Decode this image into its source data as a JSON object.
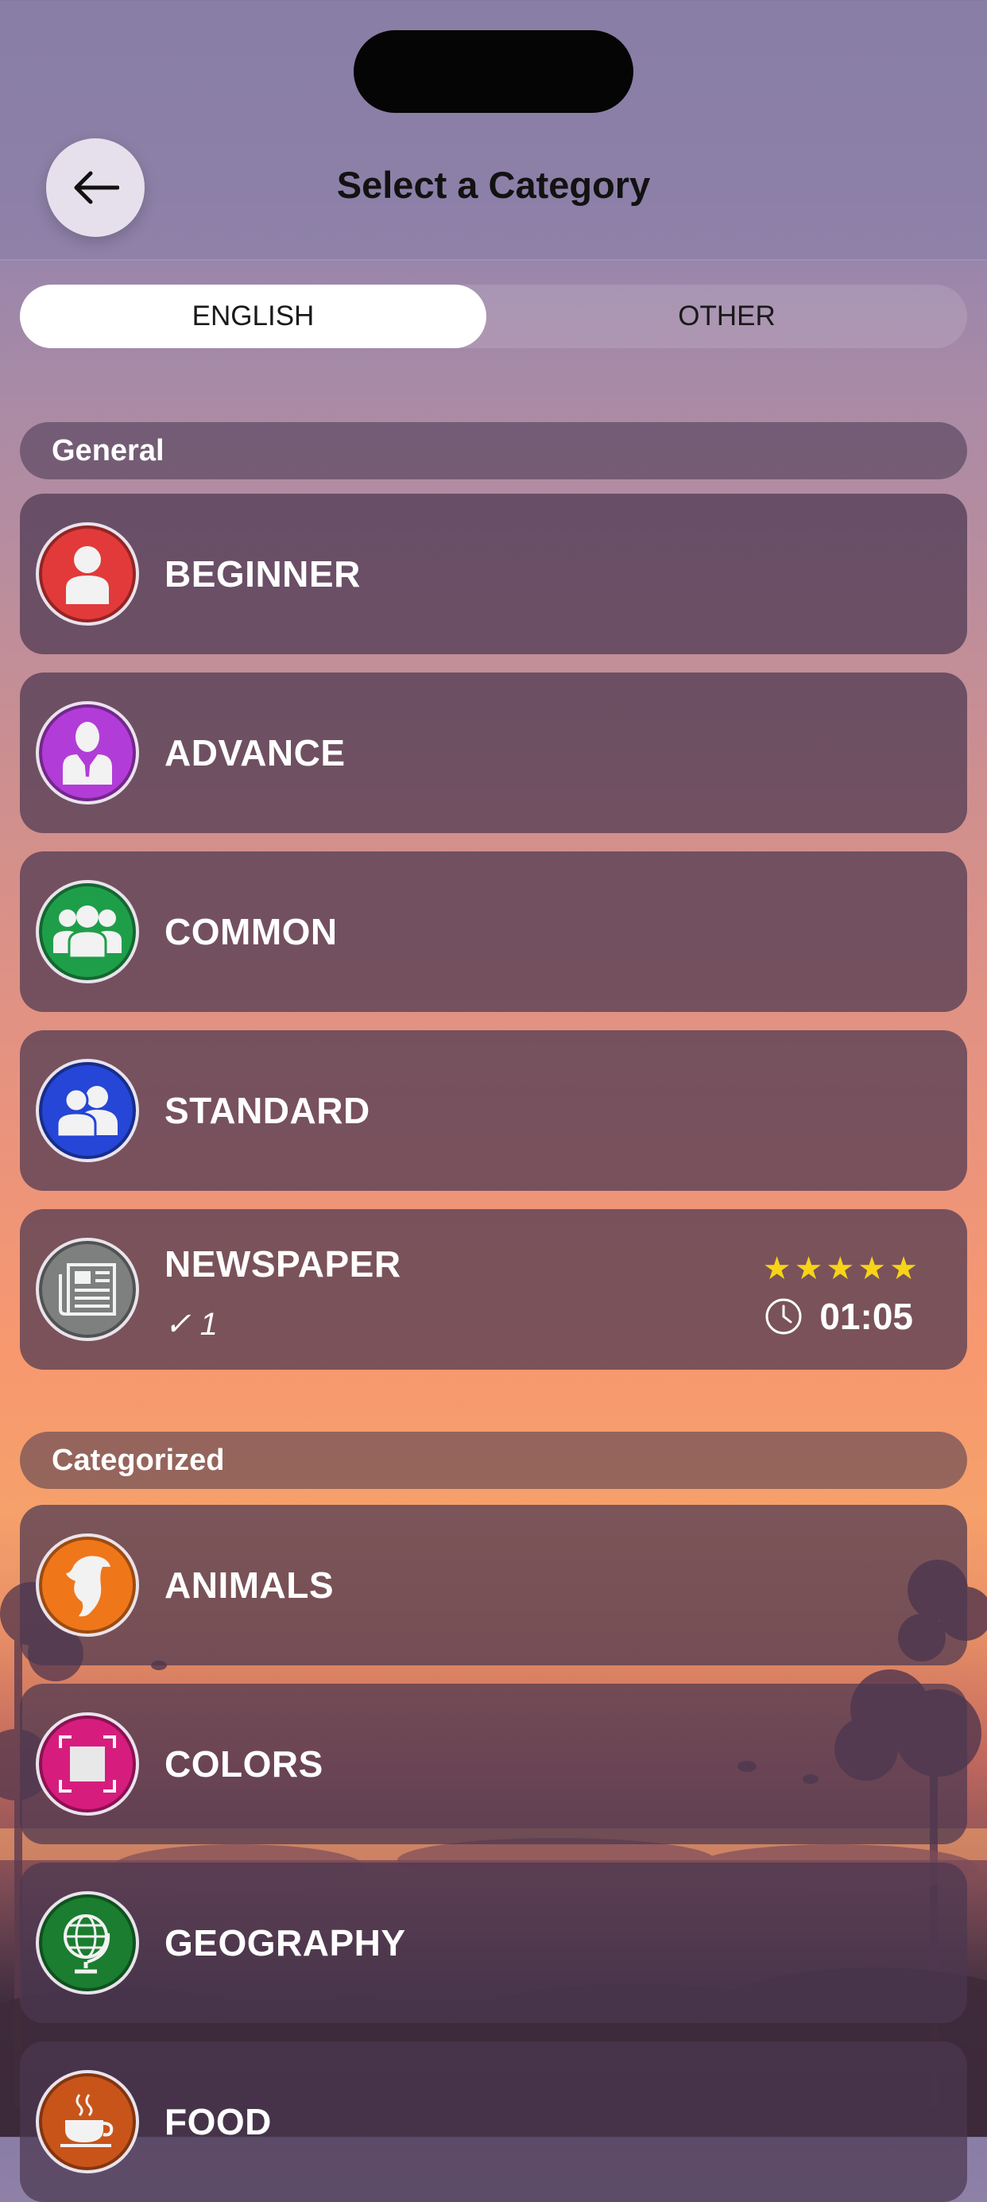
{
  "header": {
    "title": "Select a Category"
  },
  "tabs": [
    {
      "label": "ENGLISH",
      "active": true
    },
    {
      "label": "OTHER",
      "active": false
    }
  ],
  "sections": {
    "general": "General",
    "categorized": "Categorized"
  },
  "general_items": [
    {
      "label": "BEGINNER",
      "icon": "person-icon",
      "color": "#e23a3a"
    },
    {
      "label": "ADVANCE",
      "icon": "person-suit-icon",
      "color": "#b23cd8"
    },
    {
      "label": "COMMON",
      "icon": "group-icon",
      "color": "#1f9e4a"
    },
    {
      "label": "STANDARD",
      "icon": "two-people-icon",
      "color": "#2546d6"
    },
    {
      "label": "NEWSPAPER",
      "icon": "newspaper-icon",
      "color": "#7d807f",
      "completed": "✓ 1",
      "rating": "★★★★★",
      "time": "01:05"
    }
  ],
  "categorized_items": [
    {
      "label": "ANIMALS",
      "icon": "dolphin-icon",
      "color": "#f0761a"
    },
    {
      "label": "COLORS",
      "icon": "color-frame-icon",
      "color": "#d61d7e"
    },
    {
      "label": "GEOGRAPHY",
      "icon": "globe-icon",
      "color": "#1a7d2f"
    },
    {
      "label": "FOOD",
      "icon": "coffee-cup-icon",
      "color": "#c9541a"
    }
  ]
}
